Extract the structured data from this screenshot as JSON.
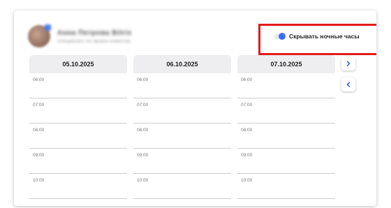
{
  "profile": {
    "name": "Анна Петрова Bitrix",
    "subtitle": "Специалист по записи клиентов"
  },
  "night_hours_toggle": {
    "label": "Скрывать ночные часы",
    "state": "on",
    "accent": "#3a6ff2"
  },
  "highlight": {
    "color": "#e31b1b"
  },
  "days": [
    {
      "date": "05.10.2025",
      "slots": [
        "06:00",
        "07:00",
        "08:00",
        "09:00",
        "10:00"
      ]
    },
    {
      "date": "06.10.2025",
      "slots": [
        "06:00",
        "07:00",
        "08:00",
        "09:00",
        "10:00"
      ]
    },
    {
      "date": "07.10.2025",
      "slots": [
        "06:00",
        "07:00",
        "08:00",
        "09:00",
        "10:00"
      ]
    }
  ],
  "nav": {
    "next_icon": "chevron-right-icon",
    "prev_icon": "chevron-left-icon",
    "icon_color": "#3a6ff2"
  }
}
